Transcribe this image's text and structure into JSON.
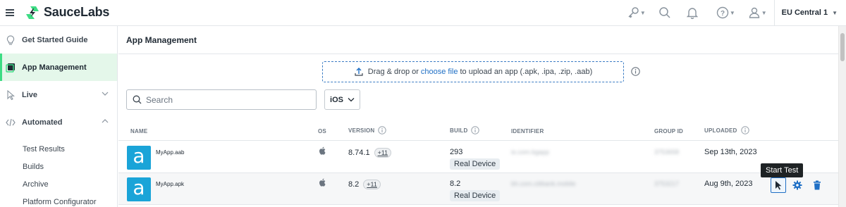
{
  "header": {
    "logo_text": "SauceLabs",
    "region": "EU Central 1"
  },
  "sidebar": {
    "items": [
      {
        "label": "Get Started Guide"
      },
      {
        "label": "App Management"
      },
      {
        "label": "Live"
      },
      {
        "label": "Automated"
      }
    ],
    "sub_items": [
      {
        "label": "Test Results"
      },
      {
        "label": "Builds"
      },
      {
        "label": "Archive"
      },
      {
        "label": "Platform Configurator"
      }
    ]
  },
  "main": {
    "title": "App Management",
    "upload": {
      "prefix": "Drag & drop or",
      "link": "choose file",
      "suffix": "to upload an app (.apk, .ipa, .zip, .aab)"
    },
    "search": {
      "placeholder": "Search",
      "value": ""
    },
    "os_select": {
      "value": "iOS"
    },
    "table": {
      "columns": {
        "name": "NAME",
        "os": "OS",
        "version": "VERSION",
        "build": "BUILD",
        "identifier": "IDENTIFIER",
        "group_id": "GROUP ID",
        "uploaded": "UPLOADED"
      },
      "rows": [
        {
          "name": "MyApp.aab",
          "version": "8.74.1",
          "more_versions": "+11",
          "build": "293",
          "badge": "Real Device",
          "identifier": "io.com.bgapp",
          "group_id": "3753658",
          "uploaded": "Sep 13th, 2023"
        },
        {
          "name": "MyApp.apk",
          "version": "8.2",
          "more_versions": "+11",
          "build": "8.2",
          "badge": "Real Device",
          "identifier": "bh.com.citibank.mobile",
          "group_id": "3753217",
          "uploaded": "Aug 9th, 2023"
        }
      ]
    },
    "tooltip": "Start Test"
  },
  "colors": {
    "brand_green": "#3ddc84",
    "active_bg": "#e4f7ea",
    "link_blue": "#1f6fc5",
    "app_icon": "#1aa4d8"
  }
}
